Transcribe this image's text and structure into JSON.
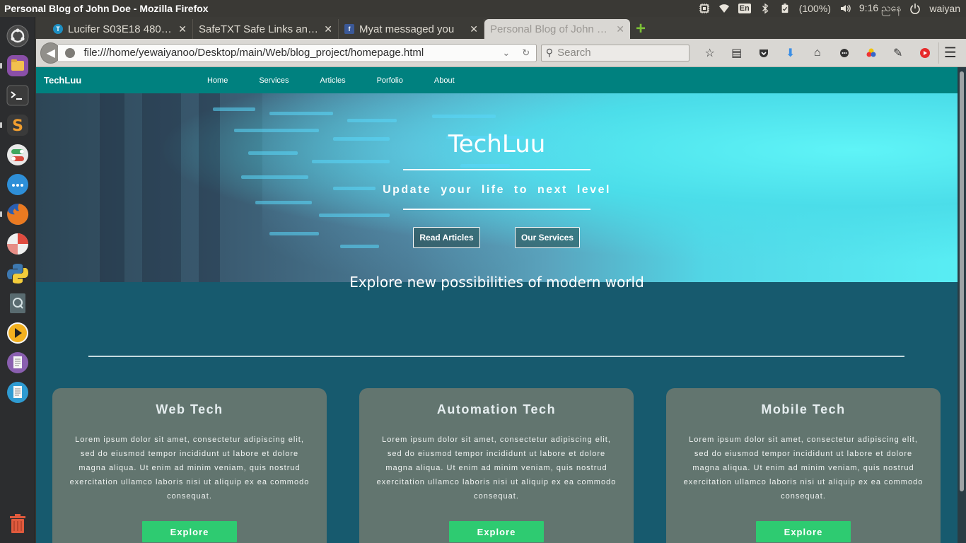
{
  "system": {
    "window_title": "Personal Blog of John Doe - Mozilla Firefox",
    "lang": "En",
    "battery": "(100%)",
    "time": "9:16 ညနေ",
    "user": "waiyan"
  },
  "browser": {
    "tabs": [
      {
        "label": "Lucifer S03E18 480p…",
        "favicon_color": "#1e8fc2",
        "favicon_text": "T"
      },
      {
        "label": "SafeTXT Safe Links and…",
        "favicon_color": "",
        "favicon_text": ""
      },
      {
        "label": "Myat messaged you",
        "favicon_color": "#3b5998",
        "favicon_text": "f"
      },
      {
        "label": "Personal Blog of John …",
        "favicon_color": "",
        "favicon_text": ""
      }
    ],
    "new_tab": "+",
    "url": "file:///home/yewaiyanoo/Desktop/main/Web/blog_project/homepage.html",
    "search_placeholder": "Search"
  },
  "site": {
    "brand": "TechLuu",
    "nav": [
      "Home",
      "Services",
      "Articles",
      "Porfolio",
      "About"
    ],
    "hero": {
      "title": "TechLuu",
      "subtitle": "Update your life to next level",
      "btn_articles": "Read Articles",
      "btn_services": "Our Services"
    },
    "explore_title": "Explore new possibilities of modern world",
    "cards": [
      {
        "title": "Web Tech",
        "body": "Lorem ipsum dolor sit amet, consectetur adipiscing elit, sed do eiusmod tempor incididunt ut labore et dolore magna aliqua. Ut enim ad minim veniam, quis nostrud exercitation ullamco laboris nisi ut aliquip ex ea commodo consequat.",
        "button": "Explore"
      },
      {
        "title": "Automation Tech",
        "body": "Lorem ipsum dolor sit amet, consectetur adipiscing elit, sed do eiusmod tempor incididunt ut labore et dolore magna aliqua. Ut enim ad minim veniam, quis nostrud exercitation ullamco laboris nisi ut aliquip ex ea commodo consequat.",
        "button": "Explore"
      },
      {
        "title": "Mobile Tech",
        "body": "Lorem ipsum dolor sit amet, consectetur adipiscing elit, sed do eiusmod tempor incididunt ut labore et dolore magna aliqua. Ut enim ad minim veniam, quis nostrud exercitation ullamco laboris nisi ut aliquip ex ea commodo consequat.",
        "button": "Explore"
      }
    ]
  },
  "colors": {
    "site_nav": "#00817f",
    "page_bg": "#175a6e",
    "card_bg": "#62756f",
    "explore_button": "#2ecb71"
  }
}
